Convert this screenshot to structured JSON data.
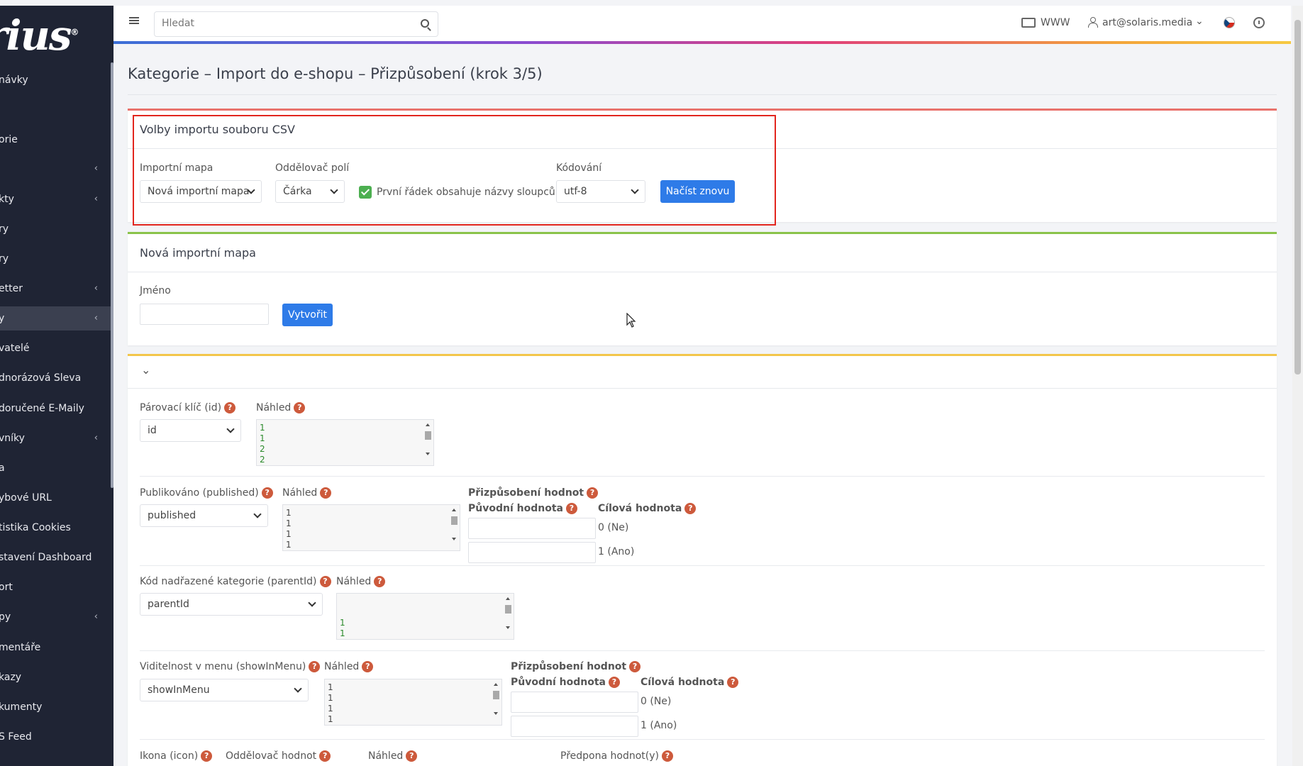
{
  "sidebar": {
    "logo": "rius",
    "items": [
      {
        "label": "návky",
        "chev": ""
      },
      {
        "label": "orie",
        "chev": ""
      },
      {
        "label": "",
        "chev": "‹"
      },
      {
        "label": "kty",
        "chev": "‹"
      },
      {
        "label": "ry",
        "chev": ""
      },
      {
        "label": "ry",
        "chev": ""
      },
      {
        "label": "etter",
        "chev": "‹"
      },
      {
        "label": "y",
        "chev": "‹"
      },
      {
        "label": "vatelé",
        "chev": ""
      },
      {
        "label": "dnorázová Sleva",
        "chev": ""
      },
      {
        "label": "doručené E-Maily",
        "chev": ""
      },
      {
        "label": "vníky",
        "chev": "‹"
      },
      {
        "label": "a",
        "chev": ""
      },
      {
        "label": "ybové URL",
        "chev": ""
      },
      {
        "label": "tistika Cookies",
        "chev": ""
      },
      {
        "label": "stavení Dashboard",
        "chev": ""
      },
      {
        "label": "ort",
        "chev": ""
      },
      {
        "label": "py",
        "chev": "‹"
      },
      {
        "label": "mentáře",
        "chev": ""
      },
      {
        "label": "kazy",
        "chev": ""
      },
      {
        "label": "kumenty",
        "chev": ""
      },
      {
        "label": "S Feed",
        "chev": ""
      }
    ]
  },
  "topbar": {
    "search_placeholder": "Hledat",
    "www": "WWW",
    "user": "art@solaris.media"
  },
  "page_title": "Kategorie – Import do e-shopu – Přizpůsobení (krok 3/5)",
  "csv_options": {
    "header": "Volby importu souboru CSV",
    "map_label": "Importní mapa",
    "map_value": "Nová importní mapa",
    "separator_label": "Oddělovač polí",
    "separator_value": "Čárka",
    "first_row_label": "První řádek obsahuje názvy sloupců",
    "first_row_checked": true,
    "encoding_label": "Kódování",
    "encoding_value": "utf-8",
    "reload_button": "Načíst znovu"
  },
  "new_map": {
    "header": "Nová importní mapa",
    "name_label": "Jméno",
    "name_value": "",
    "create_button": "Vytvořit"
  },
  "mapping": {
    "collapse_icon": "chevron-down-icon",
    "preview_label": "Náhled",
    "customize_label": "Přizpůsobení hodnot",
    "original_label": "Původní hodnota",
    "target_label": "Cílová hodnota",
    "target_no": "0 (Ne)",
    "target_yes": "1 (Ano)",
    "fields": [
      {
        "label": "Párovací klíč (id)",
        "value": "id",
        "preview": [
          "1",
          "1",
          "2",
          "2"
        ]
      },
      {
        "label": "Publikováno (published)",
        "value": "published",
        "preview": [
          "1",
          "1",
          "1",
          "1"
        ]
      },
      {
        "label": "Kód nadřazené kategorie (parentId)",
        "value": "parentId",
        "preview": [
          "",
          "",
          "1",
          "1"
        ]
      },
      {
        "label": "Viditelnost v menu (showInMenu)",
        "value": "showInMenu",
        "preview": [
          "1",
          "1",
          "1",
          "1"
        ]
      }
    ],
    "last_row": {
      "icon_label": "Ikona (icon)",
      "sep_label": "Oddělovač hodnot",
      "preview_label": "Náhled",
      "prefix_label": "Předpona hodnot(y)"
    }
  }
}
